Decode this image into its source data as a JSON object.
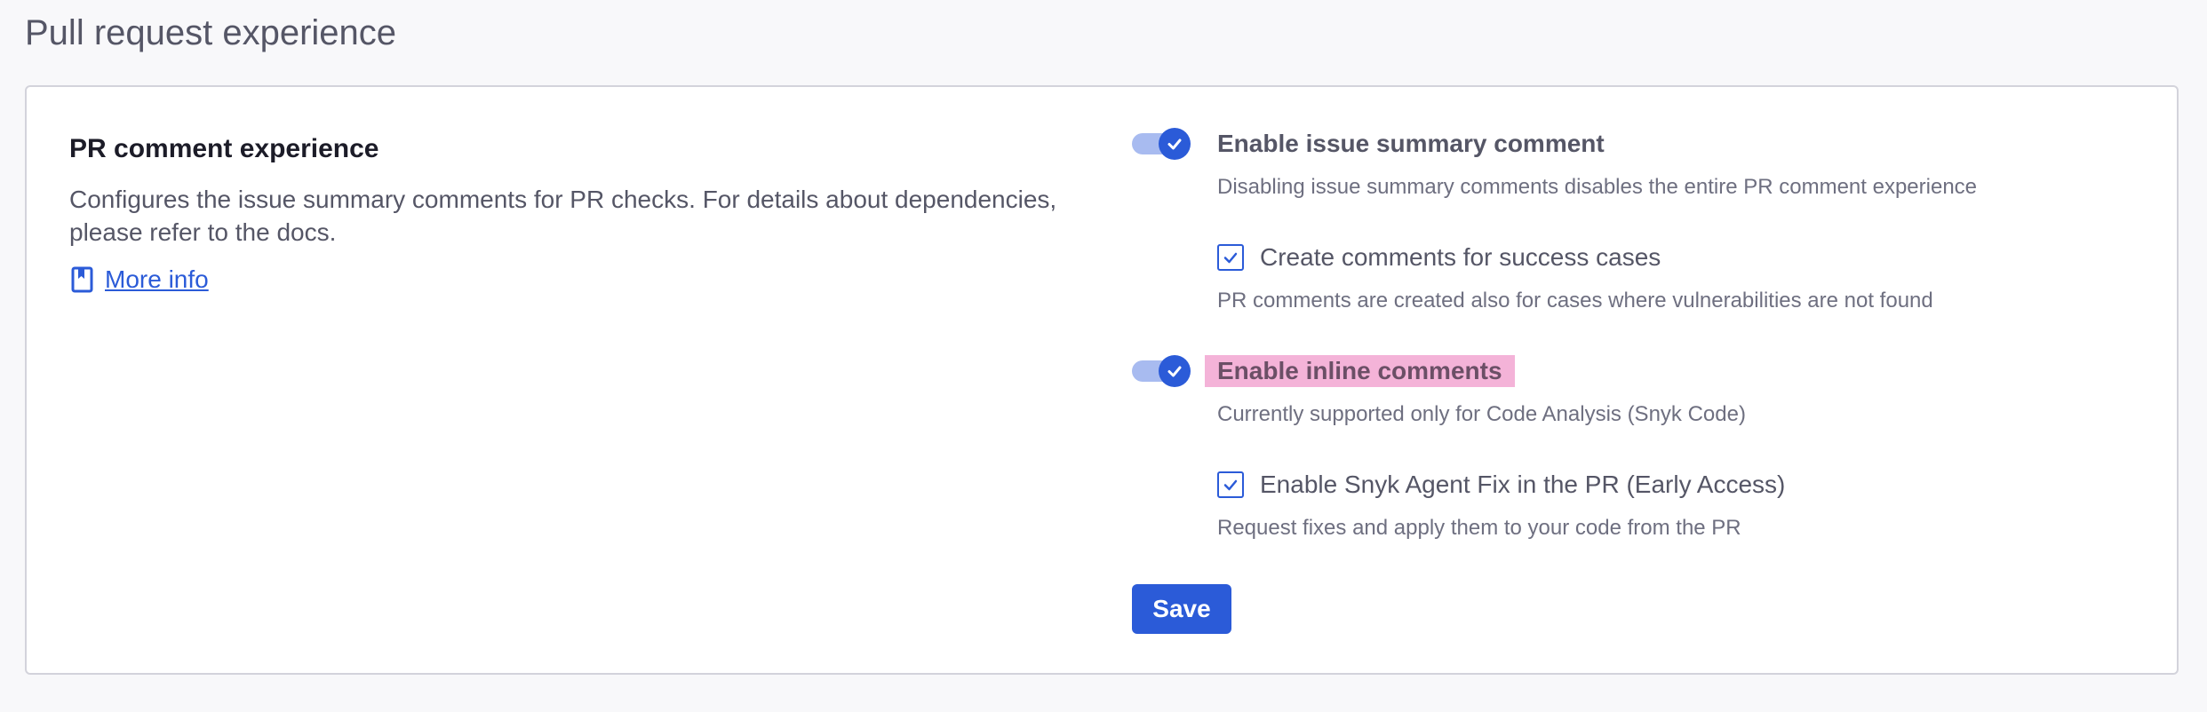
{
  "page": {
    "title": "Pull request experience"
  },
  "pr_comment": {
    "title": "PR comment experience",
    "description": "Configures the issue summary comments for PR checks. For details about dependencies, please refer to the docs.",
    "more_info_label": "More info",
    "more_info_icon": "book-icon"
  },
  "settings": {
    "issue_summary": {
      "label": "Enable issue summary comment",
      "enabled": true,
      "helper": "Disabling issue summary comments disables the entire PR comment experience"
    },
    "success_cases": {
      "label": "Create comments for success cases",
      "checked": true,
      "helper": "PR comments are created also for cases where vulnerabilities are not found"
    },
    "inline_comments": {
      "label": "Enable inline comments",
      "enabled": true,
      "helper": "Currently supported only for Code Analysis (Snyk Code)"
    },
    "agent_fix": {
      "label": "Enable Snyk Agent Fix in the PR (Early Access)",
      "checked": true,
      "helper": "Request fixes and apply them to your code from the PR"
    }
  },
  "actions": {
    "save_label": "Save"
  },
  "colors": {
    "accent": "#2b5bd8",
    "toggle_track": "#a8bbf0",
    "highlight": "#f4b3d8"
  }
}
